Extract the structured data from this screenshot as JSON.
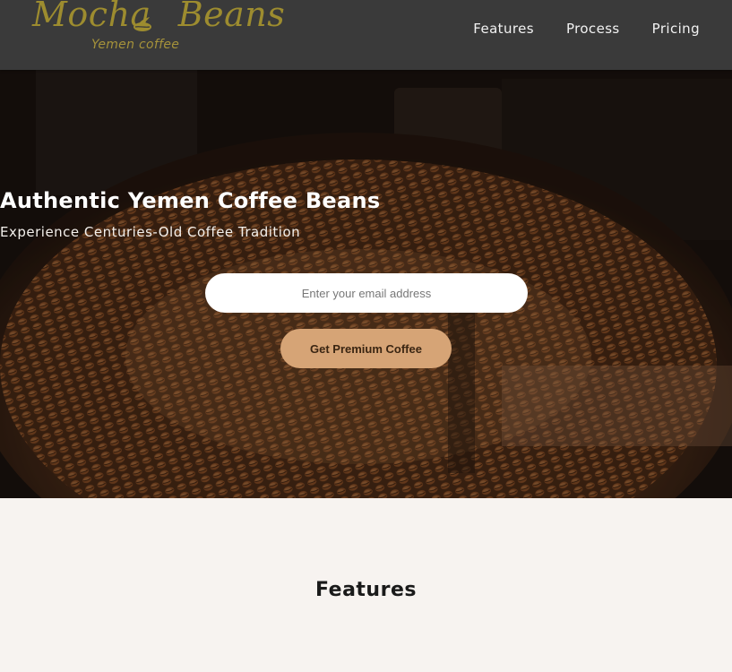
{
  "header": {
    "logo_text_1": "Mocha",
    "logo_text_2": "Beans",
    "logo_subtitle": "Yemen coffee",
    "nav": [
      {
        "label": "Features"
      },
      {
        "label": "Process"
      },
      {
        "label": "Pricing"
      }
    ]
  },
  "hero": {
    "title": "Authentic Yemen Coffee Beans",
    "subtitle": "Experience Centuries-Old Coffee Tradition",
    "email_placeholder": "Enter your email address",
    "cta_label": "Get Premium Coffee"
  },
  "features": {
    "title": "Features"
  },
  "colors": {
    "header_bg": "#3a3a3a",
    "logo_gold": "#9d8c2f",
    "cta_bg": "#d6a476",
    "section_bg": "#f7f3f0"
  },
  "icons": [
    "coffee-bean-icon"
  ]
}
